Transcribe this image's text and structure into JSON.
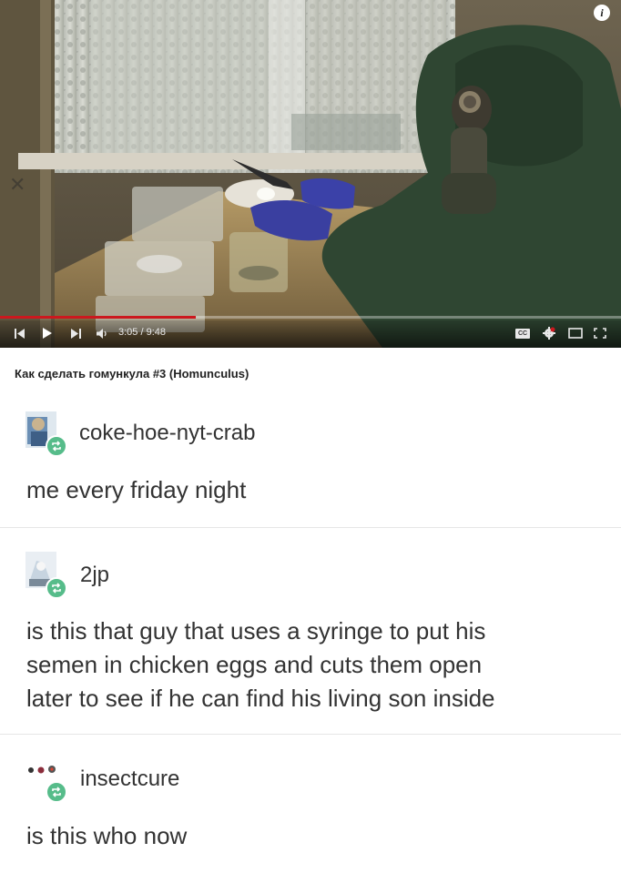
{
  "video": {
    "player_time": "3:05 / 9:48",
    "progress_fraction": 0.315,
    "accent_color": "#cc181e",
    "title": "Как сделать гомункула #3 (Homunculus)",
    "controls": [
      "skip-back-icon",
      "play-icon",
      "skip-forward-icon",
      "volume-icon",
      "captions-icon",
      "settings-icon",
      "miniplayer-icon",
      "fullscreen-icon"
    ],
    "cc_label": "CC",
    "info_label": "i"
  },
  "posts": [
    {
      "username": "coke-hoe-nyt-crab",
      "text": "me every friday night"
    },
    {
      "username": "2jp",
      "text_lines": [
        "is this that guy that uses a syringe to put his",
        "semen in chicken eggs and cuts them open",
        "later to see if he can find his living son inside"
      ]
    },
    {
      "username": "insectcure",
      "text": "is this who now"
    }
  ],
  "reblog_color": "#56bc8a"
}
